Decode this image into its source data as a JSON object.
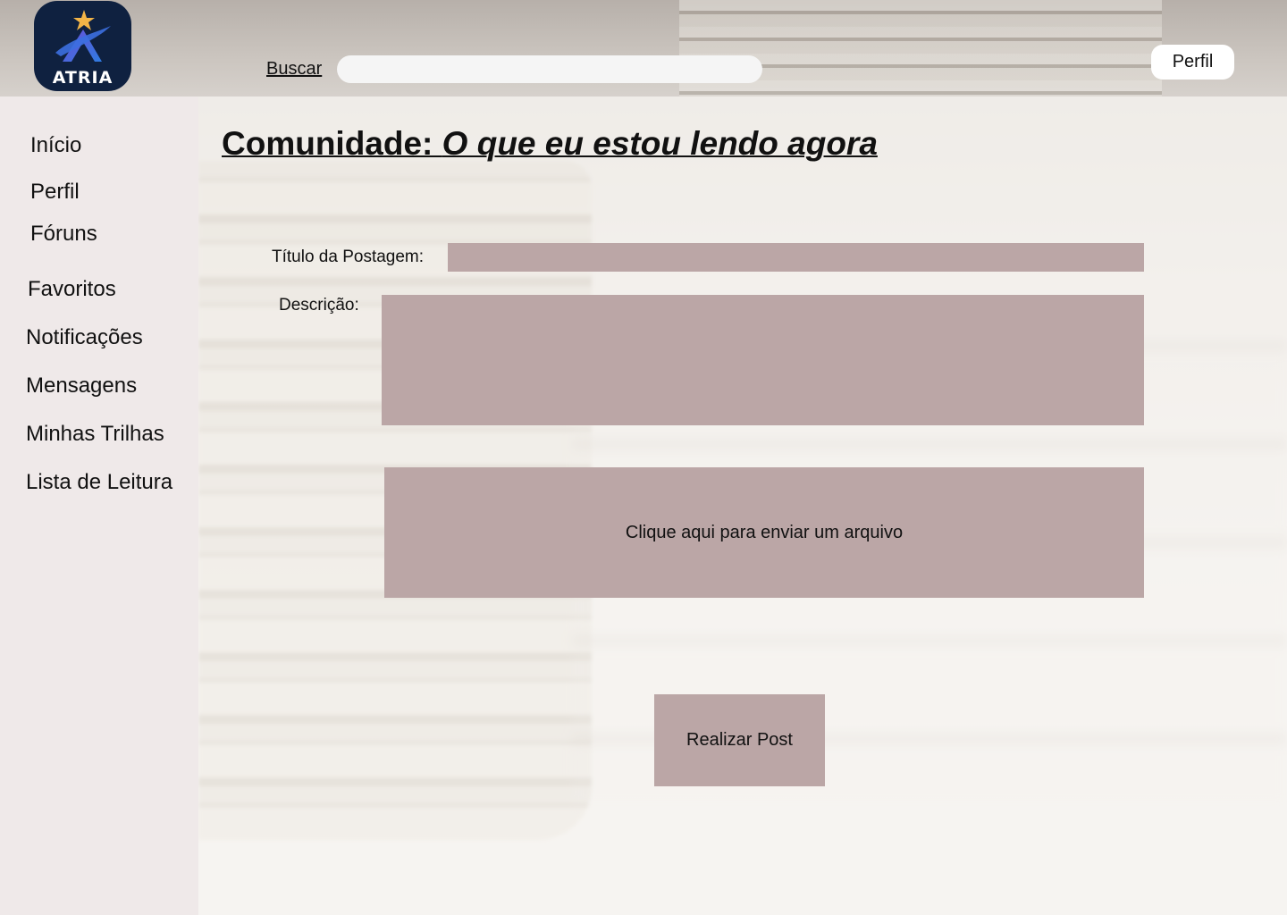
{
  "header": {
    "logo_text": "ATRIA",
    "search_label": "Buscar",
    "search_value": "",
    "profile_button": "Perfil"
  },
  "sidebar": {
    "items": [
      {
        "label": "Início"
      },
      {
        "label": "Perfil"
      },
      {
        "label": "Fóruns"
      },
      {
        "label": "Favoritos"
      },
      {
        "label": "Notificações"
      },
      {
        "label": "Mensagens"
      },
      {
        "label": "Minhas Trilhas"
      },
      {
        "label": "Lista de Leitura"
      }
    ]
  },
  "main": {
    "title_prefix": "Comunidade: ",
    "title_topic": "O que eu estou lendo agora",
    "post_title_label": "Título da Postagem:",
    "post_title_value": "",
    "description_label": "Descrição:",
    "description_value": "",
    "upload_text": "Clique aqui para enviar um arquivo",
    "submit_button": "Realizar Post"
  },
  "colors": {
    "field_bg": "#bba6a6",
    "sidebar_bg": "#efe9e9",
    "logo_bg": "#0f2140"
  }
}
